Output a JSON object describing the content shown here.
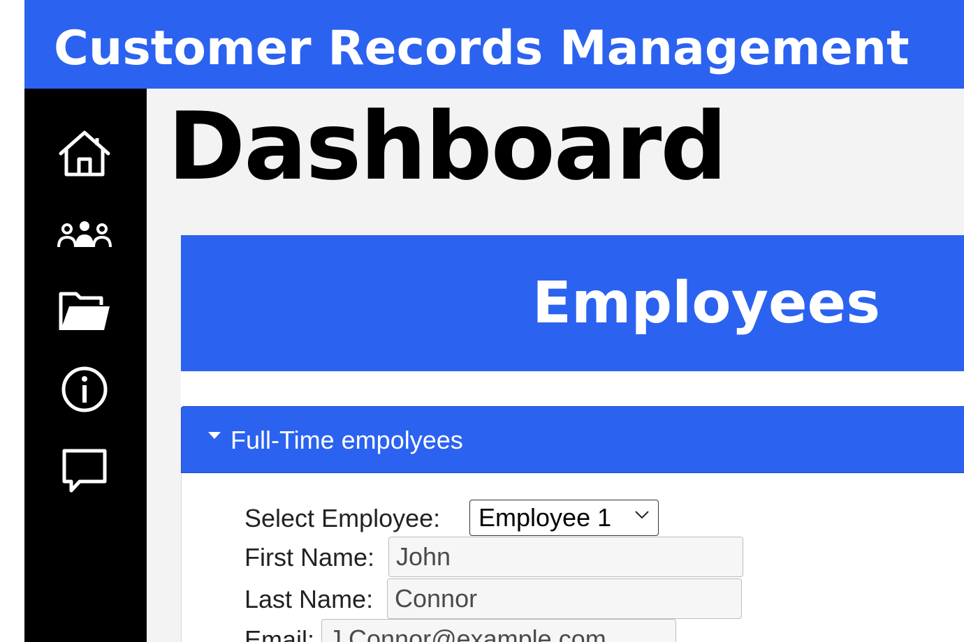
{
  "app": {
    "title": "Customer Records Management"
  },
  "sidebar": {
    "items": [
      {
        "icon": "home-icon"
      },
      {
        "icon": "users-icon"
      },
      {
        "icon": "folder-icon"
      },
      {
        "icon": "info-icon"
      },
      {
        "icon": "chat-icon"
      }
    ]
  },
  "page": {
    "title": "Dashboard"
  },
  "card": {
    "title": "Employees"
  },
  "section": {
    "title": "Full-Time empolyees",
    "expanded": true
  },
  "form": {
    "select_label": "Select Employee:",
    "select_value": "Employee 1",
    "first_name_label": "First Name:",
    "first_name_value": "John",
    "last_name_label": "Last Name:",
    "last_name_value": "Connor",
    "email_label": "Email:",
    "email_value": "J.Connor@example.com"
  },
  "colors": {
    "accent": "#2b62f0",
    "sidebar": "#000000",
    "main_bg": "#f3f3f3"
  }
}
